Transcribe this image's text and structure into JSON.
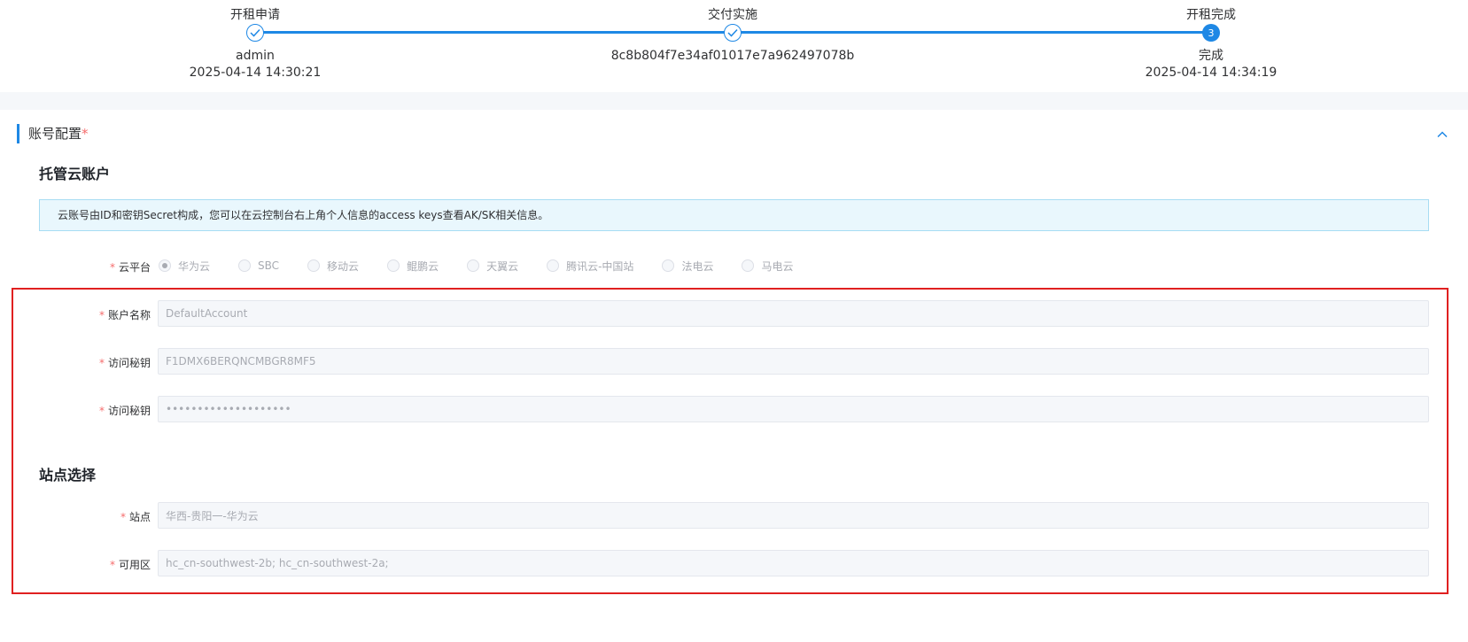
{
  "steps": [
    {
      "title": "开租申请",
      "status": "done",
      "sub1": "admin",
      "sub2": "2025-04-14 14:30:21"
    },
    {
      "title": "交付实施",
      "status": "done",
      "sub1": "8c8b804f7e34af01017e7a962497078b",
      "sub2": ""
    },
    {
      "title": "开租完成",
      "status": "current",
      "number": "3",
      "sub1": "完成",
      "sub2": "2025-04-14 14:34:19"
    }
  ],
  "section": {
    "title": "账号配置",
    "required_mark": "*"
  },
  "hosted_account": {
    "title": "托管云账户",
    "alert": "云账号由ID和密钥Secret构成，您可以在云控制台右上角个人信息的access keys查看AK/SK相关信息。",
    "platform_label": "云平台",
    "platforms": [
      "华为云",
      "SBC",
      "移动云",
      "鲲鹏云",
      "天翼云",
      "腾讯云-中国站",
      "法电云",
      "马电云"
    ],
    "selected_platform": "华为云",
    "fields": [
      {
        "label": "账户名称",
        "value": "DefaultAccount"
      },
      {
        "label": "访问秘钥",
        "value": "F1DMX6BERQNCMBGR8MF5"
      },
      {
        "label": "访问秘钥",
        "value": "••••••••••••••••••••"
      }
    ]
  },
  "site_selection": {
    "title": "站点选择",
    "fields": [
      {
        "label": "站点",
        "value": "华西-贵阳一-华为云"
      },
      {
        "label": "可用区",
        "value": "hc_cn-southwest-2b; hc_cn-southwest-2a;"
      }
    ]
  },
  "colors": {
    "accent": "#1e88e5",
    "required": "#f56c6c",
    "highlight_box": "#e02020"
  }
}
